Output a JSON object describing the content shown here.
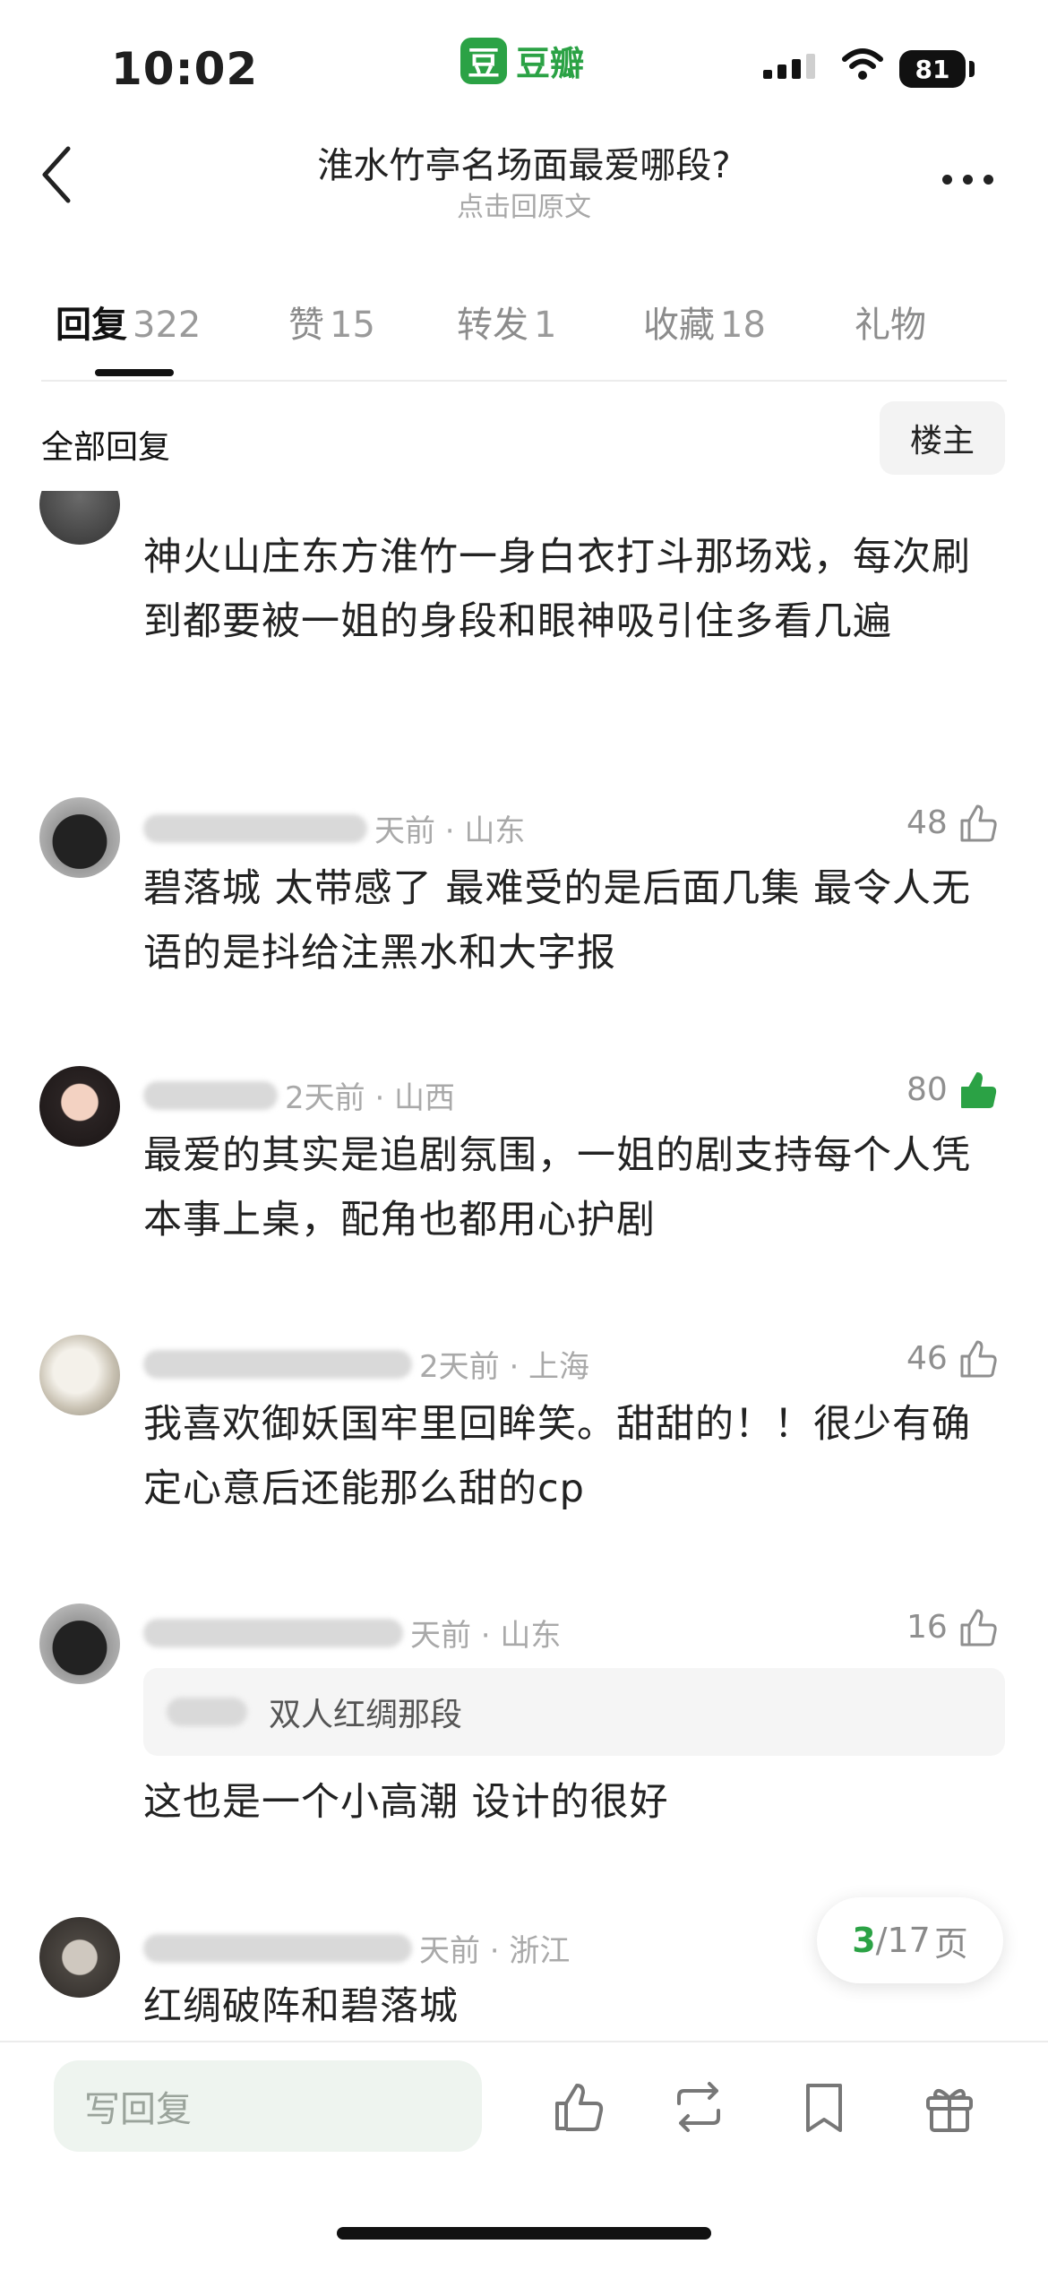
{
  "status_bar": {
    "time": "10:02",
    "battery": "81"
  },
  "app": {
    "logo_char": "豆",
    "name": "豆瓣"
  },
  "header": {
    "title": "淮水竹亭名场面最爱哪段?",
    "subtitle": "点击回原文"
  },
  "tabs": [
    {
      "label": "回复",
      "count": "322"
    },
    {
      "label": "赞",
      "count": "15"
    },
    {
      "label": "转发",
      "count": "1"
    },
    {
      "label": "收藏",
      "count": "18"
    },
    {
      "label": "礼物",
      "count": ""
    }
  ],
  "filter": {
    "label": "全部回复",
    "op_button": "楼主"
  },
  "comments": [
    {
      "meta": "",
      "likes": "",
      "text": "神火山庄东方淮竹一身白衣打斗那场戏，每次刷到都要被一姐的身段和眼神吸引住多看几遍"
    },
    {
      "meta": "天前 · 山东",
      "likes": "48",
      "text": "碧落城 太带感了 最难受的是后面几集  最令人无语的是抖给注黑水和大字报"
    },
    {
      "meta": "2天前 · 山西",
      "likes": "80",
      "text": "最爱的其实是追剧氛围，一姐的剧支持每个人凭本事上桌，配角也都用心护剧"
    },
    {
      "meta": "2天前 · 上海",
      "likes": "46",
      "text": "我喜欢御妖国牢里回眸笑。甜甜的！！很少有确定心意后还能那么甜的cp"
    },
    {
      "meta": "天前 · 山东",
      "likes": "16",
      "quote": "双人红绸那段",
      "text": "这也是一个小高潮 设计的很好"
    },
    {
      "meta": "天前 · 浙江",
      "likes": "",
      "text": "红绸破阵和碧落城"
    }
  ],
  "pagination": {
    "current": "3",
    "total": "/17",
    "unit": "页"
  },
  "bottom": {
    "reply_placeholder": "写回复"
  },
  "colors": {
    "accent": "#2ba245",
    "like_active": "#2ba245"
  }
}
